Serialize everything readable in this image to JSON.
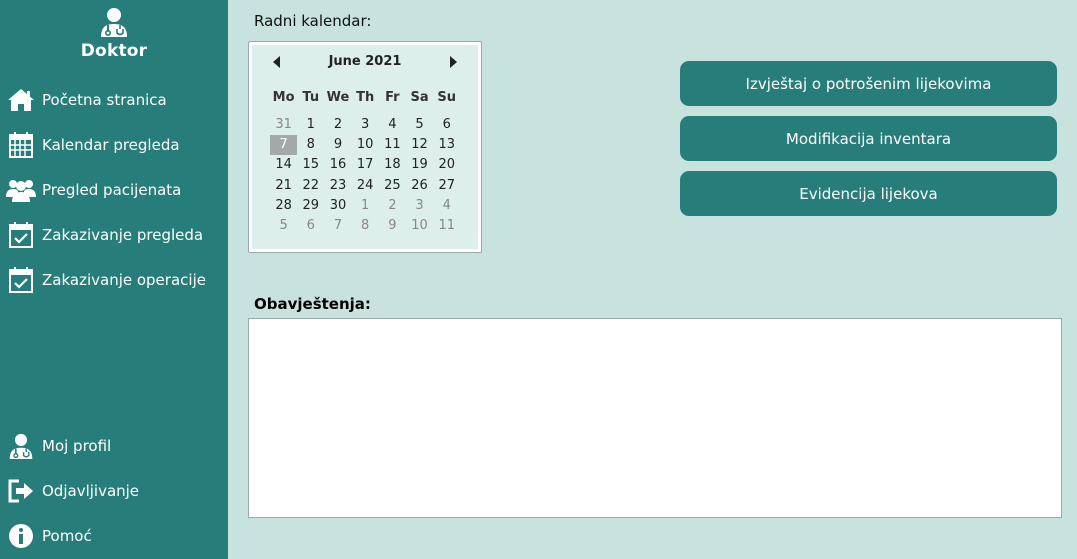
{
  "sidebar": {
    "title": "Doktor",
    "items": [
      {
        "label": "Početna stranica",
        "icon": "home-icon"
      },
      {
        "label": "Kalendar pregleda",
        "icon": "calendar-icon"
      },
      {
        "label": "Pregled pacijenata",
        "icon": "users-icon"
      },
      {
        "label": "Zakazivanje pregleda",
        "icon": "calendar-check-icon"
      },
      {
        "label": "Zakazivanje operacije",
        "icon": "calendar-check-icon"
      }
    ],
    "bottom_items": [
      {
        "label": "Moj profil",
        "icon": "doctor-icon"
      },
      {
        "label": "Odjavljivanje",
        "icon": "logout-icon"
      },
      {
        "label": "Pomoć",
        "icon": "info-icon"
      }
    ]
  },
  "calendar": {
    "label": "Radni kalendar:",
    "month": "June 2021",
    "days_of_week": [
      "Mo",
      "Tu",
      "We",
      "Th",
      "Fr",
      "Sa",
      "Su"
    ],
    "selected": "7",
    "weeks": [
      [
        "31",
        "1",
        "2",
        "3",
        "4",
        "5",
        "6"
      ],
      [
        "7",
        "8",
        "9",
        "10",
        "11",
        "12",
        "13"
      ],
      [
        "14",
        "15",
        "16",
        "17",
        "18",
        "19",
        "20"
      ],
      [
        "21",
        "22",
        "23",
        "24",
        "25",
        "26",
        "27"
      ],
      [
        "28",
        "29",
        "30",
        "1",
        "2",
        "3",
        "4"
      ],
      [
        "5",
        "6",
        "7",
        "8",
        "9",
        "10",
        "11"
      ]
    ],
    "other_month_flags": [
      [
        true,
        false,
        false,
        false,
        false,
        false,
        false
      ],
      [
        false,
        false,
        false,
        false,
        false,
        false,
        false
      ],
      [
        false,
        false,
        false,
        false,
        false,
        false,
        false
      ],
      [
        false,
        false,
        false,
        false,
        false,
        false,
        false
      ],
      [
        false,
        false,
        false,
        true,
        true,
        true,
        true
      ],
      [
        true,
        true,
        true,
        true,
        true,
        true,
        true
      ]
    ]
  },
  "actions": {
    "report": "Izvještaj o potrošenim lijekovima",
    "inventory": "Modifikacija inventara",
    "medicines": "Evidencija lijekova"
  },
  "notifications": {
    "label": "Obavještenja:"
  },
  "colors": {
    "sidebar": "#277d7a",
    "background": "#c8e3dd",
    "calendar_bg": "#dcefeb",
    "selected_day": "#a3a9a8"
  }
}
